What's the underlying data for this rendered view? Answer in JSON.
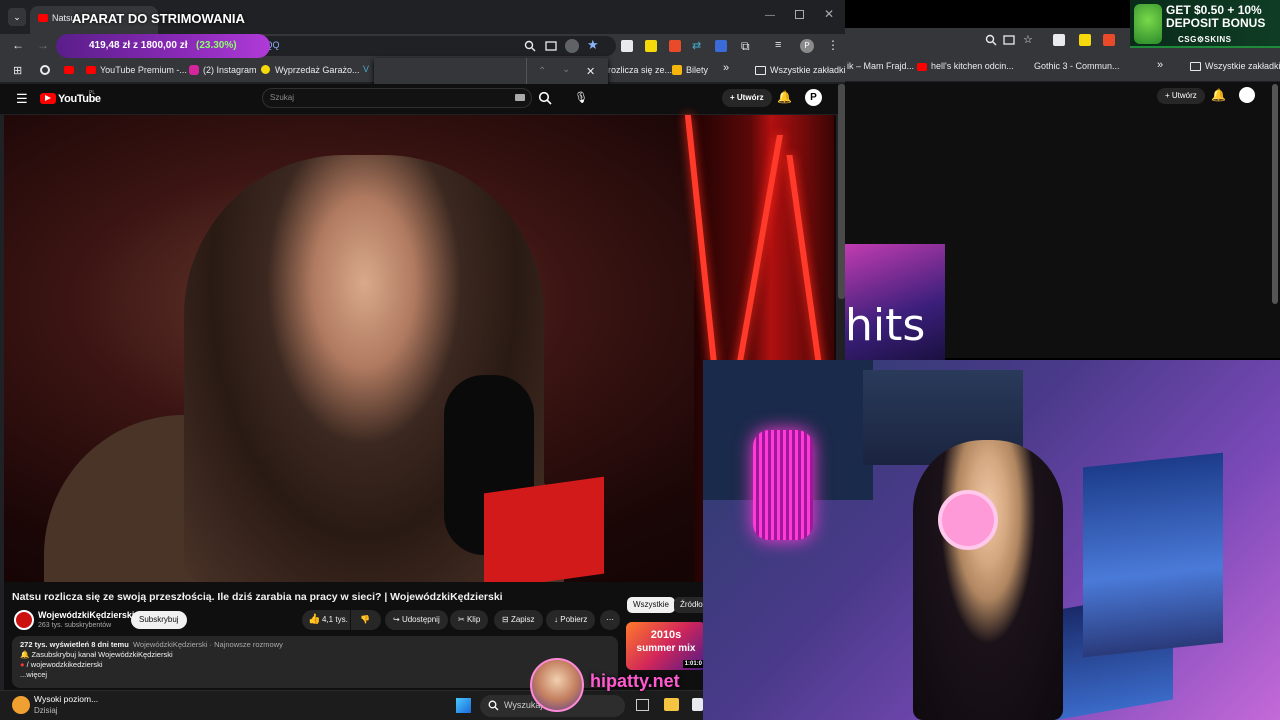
{
  "overlay": {
    "title": "APARAT DO STRIMOWANIA",
    "money": {
      "current": "419,48 zł",
      "of": "z 1800,00 zł",
      "percent": "(23.30%)"
    },
    "url_fragment": "ItuHCIQQ"
  },
  "ad": {
    "line1": "GET $0.50 + 10%",
    "line2": "DEPOSIT BONUS",
    "brand": "CSG⚙SKINS"
  },
  "browser": {
    "tab_title": "Natsu",
    "bookmarks": [
      {
        "label": "YouTube Premium -..."
      },
      {
        "label": "(2) Instagram"
      },
      {
        "label": "Wyprzedaż Garażo..."
      },
      {
        "label": "rozlicza się ze..."
      },
      {
        "label": "Bilety"
      },
      {
        "label": "Wszystkie zakładki"
      }
    ]
  },
  "back_window": {
    "bookmarks": [
      {
        "label": "ik – Mam Frajd..."
      },
      {
        "label": "hell's kitchen odcin..."
      },
      {
        "label": "Gothic 3 - Commun..."
      },
      {
        "label": "Wszystkie zakładki"
      }
    ],
    "create_label": "Utwórz",
    "preview_text": "hits"
  },
  "youtube": {
    "logo_text": "YouTube",
    "logo_sup": "PL",
    "search_placeholder": "Szukaj",
    "create_label": "Utwórz",
    "video_title": "Natsu rozlicza się ze swoją przeszłością. Ile dziś zarabia na pracy w sieci? | WojewódzkiKędzierski",
    "channel": "WojewódzkiKędzierski",
    "subscribers": "263 tys. subskrybentów",
    "subscribe_label": "Subskrybuj",
    "likes": "4,1 tys.",
    "share_label": "Udostępnij",
    "clip_label": "Klip",
    "save_label": "Zapisz",
    "download_label": "Pobierz",
    "chips": {
      "all": "Wszystkie",
      "source": "Źródło"
    },
    "description": {
      "line1_views": "272 tys. wyświetleń  8 dni temu",
      "line1_tags": "WojewódzkiKędzierski · Najnowsze rozmowy",
      "line2": "Zasubskrybuj kanał WojewódzkiKędzierski",
      "line3": "/ wojewodzkikedzierski",
      "more": "...więcej"
    },
    "suggested": {
      "title": "2010s",
      "subtitle": "summer mix",
      "duration": "1:01:0"
    }
  },
  "taskbar": {
    "weather_title": "Wysoki poziom...",
    "weather_sub": "Dzisiaj",
    "search_placeholder": "Wyszukaj"
  },
  "watermark": "hipatty.net"
}
